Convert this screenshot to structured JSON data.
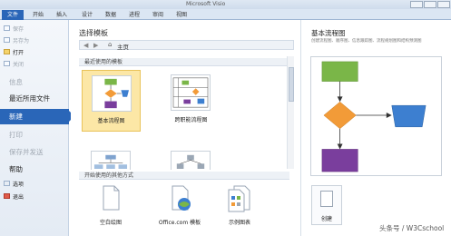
{
  "window": {
    "title": "Microsoft Visio"
  },
  "ribbon": {
    "tabs": [
      {
        "label": "文件"
      },
      {
        "label": "开始"
      },
      {
        "label": "插入"
      },
      {
        "label": "设计"
      },
      {
        "label": "数据"
      },
      {
        "label": "进程"
      },
      {
        "label": "审阅"
      },
      {
        "label": "视图"
      }
    ]
  },
  "nav": {
    "save": "保存",
    "save_as": "另存为",
    "open": "打开",
    "close": "关闭",
    "info": "信息",
    "recent": "最近所用文件",
    "new": "新建",
    "print": "打印",
    "save_send": "保存并发送",
    "help": "帮助",
    "options": "选项",
    "exit": "退出"
  },
  "center": {
    "section_title": "选择模板",
    "breadcrumb_home": "主页",
    "recent_group": "最近使用的模板",
    "other_group": "开始使用的其他方式",
    "recent_templates": [
      {
        "label": "基本流程图"
      },
      {
        "label": "跨职能流程图"
      },
      {
        "label": ""
      },
      {
        "label": ""
      }
    ],
    "other_ways": [
      {
        "label": "空白绘图"
      },
      {
        "label": "Office.com 模板"
      },
      {
        "label": "示例图表"
      }
    ]
  },
  "right": {
    "title": "基本流程图",
    "description": "创建流程图、顺序图、信息跟踪图、流程规划图和结构预测图",
    "create_label": "创建"
  },
  "watermark": "头条号 / W3Cschool",
  "colors": {
    "accent": "#2a66b8",
    "selected": "#fce7a6",
    "green": "#7ab648",
    "orange": "#f29b38",
    "blue": "#3d7fd0",
    "purple": "#7a3e9d"
  }
}
